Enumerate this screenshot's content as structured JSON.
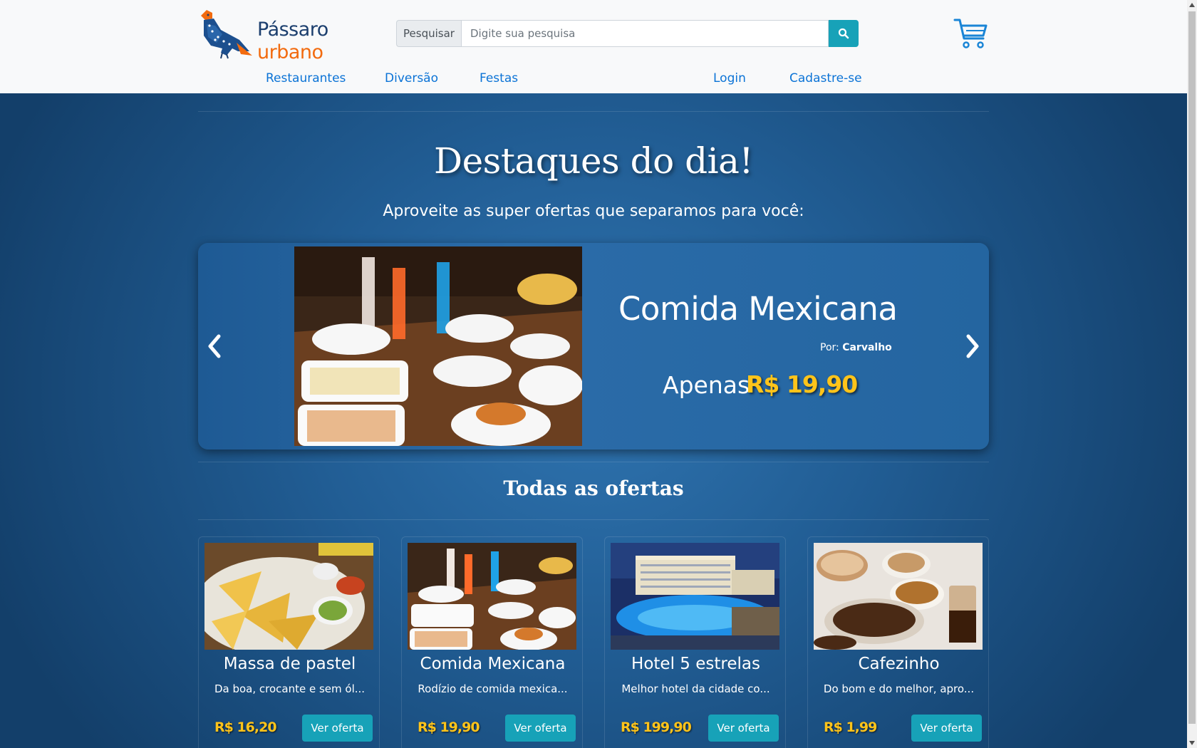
{
  "brand": {
    "line1": "Pássaro",
    "line2": "urbano"
  },
  "search": {
    "label": "Pesquisar",
    "placeholder": "Digite sua pesquisa"
  },
  "nav": {
    "restaurantes": "Restaurantes",
    "diversao": "Diversão",
    "festas": "Festas",
    "login": "Login",
    "cadastro": "Cadastre-se"
  },
  "hero": {
    "title": "Destaques do dia!",
    "subtitle": "Aproveite as super ofertas que separamos para você:"
  },
  "carousel": {
    "title": "Comida Mexicana",
    "by_label": "Por:",
    "by_name": "Carvalho",
    "price_label": "Apenas",
    "price": "R$ 19,90"
  },
  "offers_title": "Todas as ofertas",
  "offers": [
    {
      "title": "Massa de pastel",
      "desc": "Da boa, crocante e sem ól...",
      "price": "R$ 16,20",
      "button": "Ver oferta"
    },
    {
      "title": "Comida Mexicana",
      "desc": "Rodízio de comida mexica...",
      "price": "R$ 19,90",
      "button": "Ver oferta"
    },
    {
      "title": "Hotel 5 estrelas",
      "desc": "Melhor hotel da cidade co...",
      "price": "R$ 199,90",
      "button": "Ver oferta"
    },
    {
      "title": "Cafezinho",
      "desc": "Do bom e do melhor, apro...",
      "price": "R$ 1,99",
      "button": "Ver oferta"
    }
  ],
  "colors": {
    "accent": "#17a2b8",
    "link": "#0b73d6",
    "price": "#ffc41a",
    "brand_blue": "#1c3f6e",
    "brand_orange": "#f26b0f"
  },
  "icons": {
    "search": "search-icon",
    "cart": "cart-icon",
    "prev": "chevron-left-icon",
    "next": "chevron-right-icon"
  }
}
